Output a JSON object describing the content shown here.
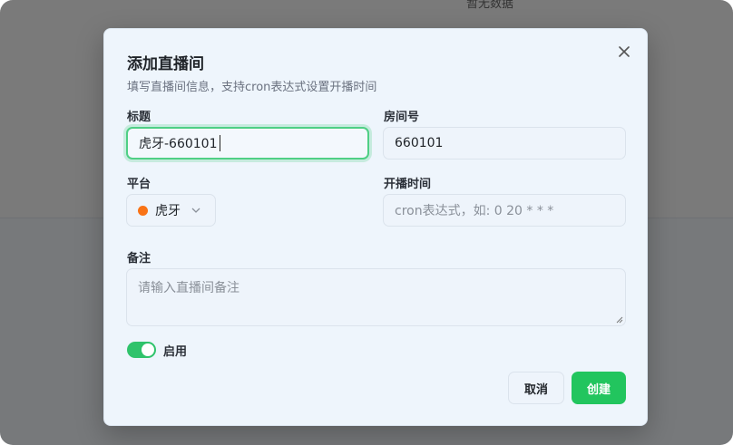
{
  "background": {
    "empty_text": "暂无数据"
  },
  "dialog": {
    "title": "添加直播间",
    "subtitle": "填写直播间信息，支持cron表达式设置开播时间",
    "fields": {
      "title_label": "标题",
      "title_value": "虎牙-660101",
      "room_label": "房间号",
      "room_value": "660101",
      "platform_label": "平台",
      "platform_value": "虎牙",
      "platform_color": "#f97316",
      "schedule_label": "开播时间",
      "schedule_placeholder": "cron表达式，如: 0 20 * * *",
      "note_label": "备注",
      "note_placeholder": "请输入直播间备注"
    },
    "toggle": {
      "label": "启用",
      "on": true
    },
    "buttons": {
      "cancel": "取消",
      "create": "创建"
    },
    "accent_color": "#22c55e"
  }
}
